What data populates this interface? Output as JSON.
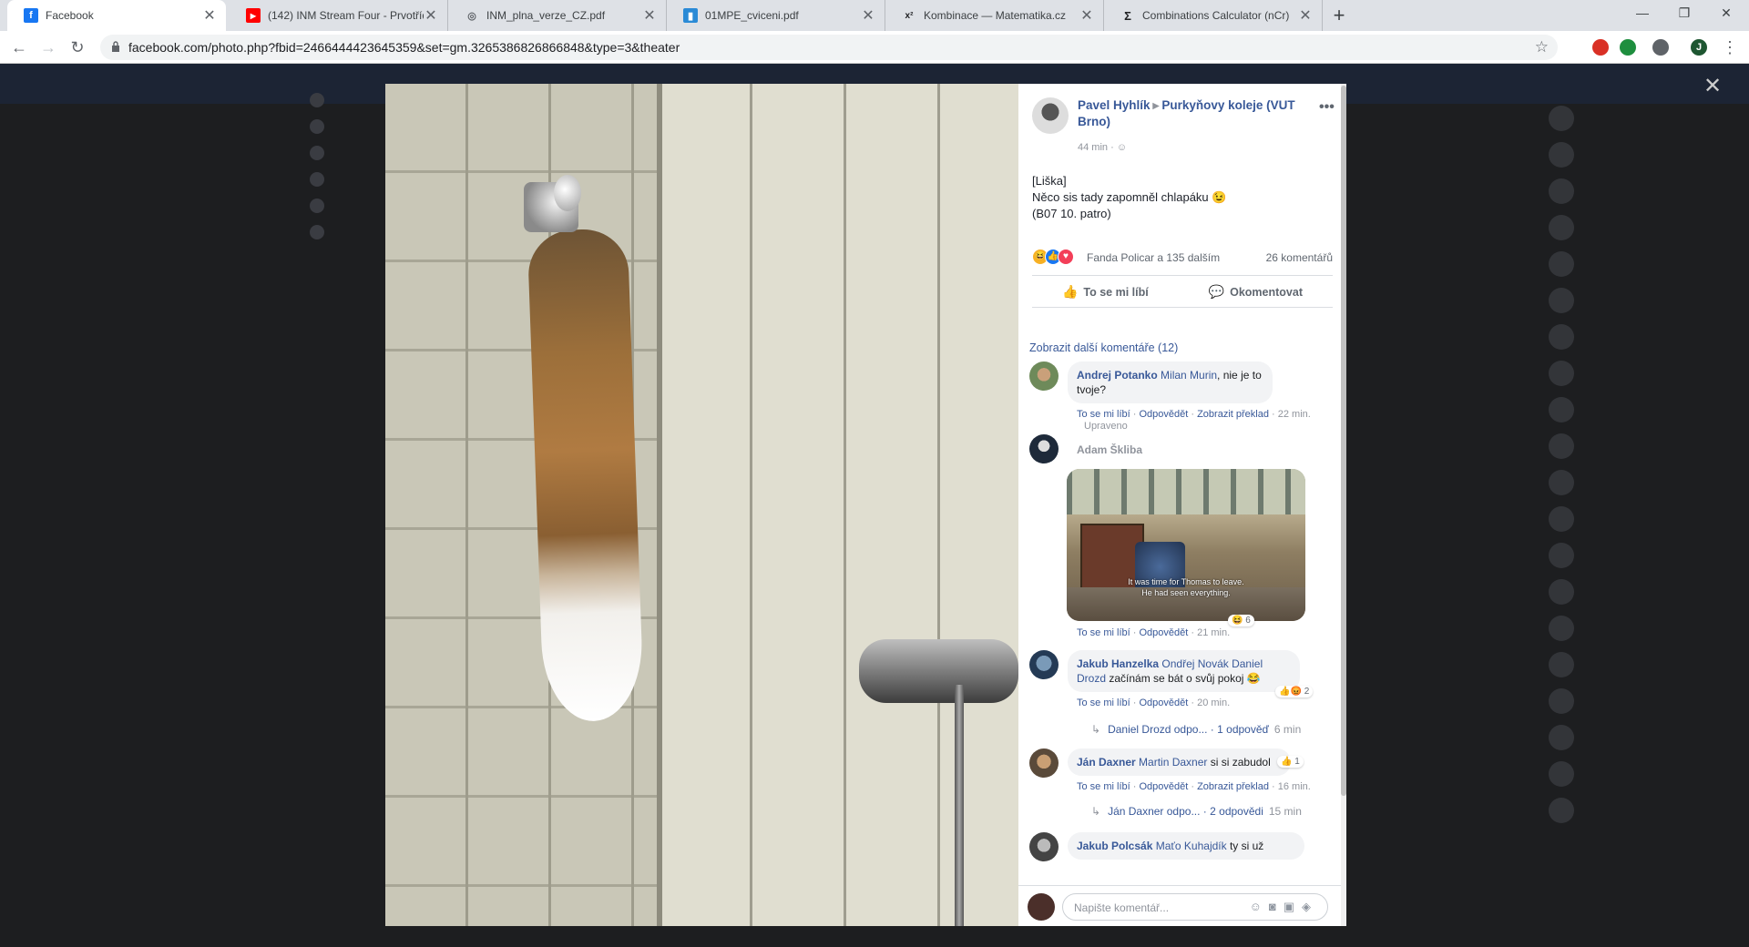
{
  "browser": {
    "tabs": [
      {
        "title": "Facebook",
        "icon": "facebook-icon",
        "color": "#1877f2",
        "glyph": "f"
      },
      {
        "title": "(142) INM Stream Four - Prvotříd",
        "icon": "youtube-icon",
        "color": "#ff0000",
        "glyph": "▶"
      },
      {
        "title": "INM_plna_verze_CZ.pdf",
        "icon": "globe-icon",
        "color": "#5f6368",
        "glyph": "◎"
      },
      {
        "title": "01MPE_cviceni.pdf",
        "icon": "pdf-icon",
        "color": "#2a8ad6",
        "glyph": "▮"
      },
      {
        "title": "Kombinace — Matematika.cz",
        "icon": "math-icon",
        "color": "#202124",
        "glyph": "x²"
      },
      {
        "title": "Combinations Calculator (nCr)",
        "icon": "sigma-icon",
        "color": "#202124",
        "glyph": "Σ"
      }
    ],
    "new_tab": "+",
    "window_controls": {
      "minimize": "—",
      "maximize": "❐",
      "close": "✕"
    },
    "url": "facebook.com/photo.php?fbid=2466444423645359&set=gm.3265386826866848&type=3&theater",
    "profile_initial": "J"
  },
  "post": {
    "author": "Pavel Hyhlík",
    "group": "Purkyňovy koleje (VUT Brno)",
    "time": "44 min",
    "text_lines": [
      "[Liška]",
      "Něco sis tady zapomněl chlapáku 😉",
      "(B07 10. patro)"
    ],
    "reactions_names": "Fanda Policar a 135 dalším",
    "comments_count": "26 komentářů",
    "like_label": "To se mi líbí",
    "comment_label": "Okomentovat"
  },
  "comments_more": "Zobrazit další komentáře (12)",
  "comments": [
    {
      "author": "Andrej Potanko",
      "tag": "Milan Murin",
      "text": ", nie je to tvoje?",
      "like": "To se mi líbí",
      "reply": "Odpovědět",
      "translate": "Zobrazit překlad",
      "time": "22 min.",
      "edited": "Upraveno"
    },
    {
      "author": "Adam Škliba",
      "like": "To se mi líbí",
      "reply": "Odpovědět",
      "time": "21 min.",
      "meme_caption": "It was time for Thomas to leave.\nHe had seen everything.",
      "react_count": "6"
    },
    {
      "author": "Jakub Hanzelka",
      "tag": "Ondřej Novák Daniel Drozd",
      "text": " začínám se bát o svůj pokoj 😂",
      "like": "To se mi líbí",
      "reply": "Odpovědět",
      "time": "20 min.",
      "react_count": "2",
      "reply_author": "Daniel Drozd odpo...",
      "reply_count": "1 odpověď",
      "reply_time": "6 min"
    },
    {
      "author": "Ján Daxner",
      "tag": "Martin Daxner",
      "text": " si si zabudol",
      "like": "To se mi líbí",
      "reply": "Odpovědět",
      "translate": "Zobrazit překlad",
      "time": "16 min.",
      "react_count": "1",
      "reply_author": "Ján Daxner odpo...",
      "reply_count": "2 odpovědi",
      "reply_time": "15 min"
    },
    {
      "author": "Jakub Polcsák",
      "tag": "Maťo Kuhajdík",
      "text": " ty si už"
    }
  ],
  "composer_placeholder": "Napište komentář...",
  "close_label": "✕",
  "colors": {
    "fb_link": "#385898",
    "fb_blue": "#1877f2"
  }
}
